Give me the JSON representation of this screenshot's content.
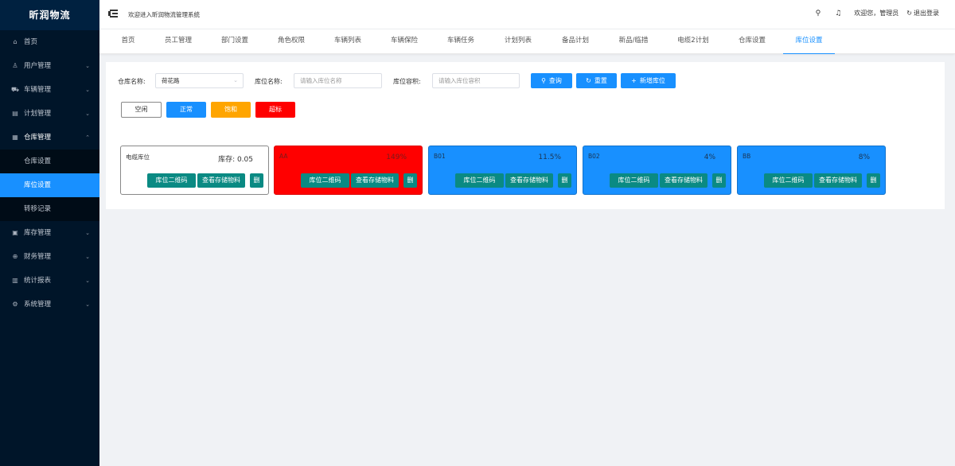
{
  "sidebar": {
    "logo": "昕润物流",
    "items": [
      {
        "label": "首页",
        "icon": "home-icon",
        "glyph": "⌂",
        "arrow": ""
      },
      {
        "label": "用户管理",
        "icon": "user-icon",
        "glyph": "♙",
        "arrow": "⌄"
      },
      {
        "label": "车辆管理",
        "icon": "car-icon",
        "glyph": "⛟",
        "arrow": "⌄"
      },
      {
        "label": "计划管理",
        "icon": "document-icon",
        "glyph": "▤",
        "arrow": "⌄"
      },
      {
        "label": "仓库管理",
        "icon": "warehouse-icon",
        "glyph": "▦",
        "arrow": "⌃"
      }
    ],
    "subitems": [
      {
        "label": "仓库设置"
      },
      {
        "label": "库位设置"
      },
      {
        "label": "转移记录"
      }
    ],
    "items_after": [
      {
        "label": "库存管理",
        "icon": "calendar-icon",
        "glyph": "▣",
        "arrow": "⌄"
      },
      {
        "label": "财务管理",
        "icon": "finance-icon",
        "glyph": "⊕",
        "arrow": "⌄"
      },
      {
        "label": "统计报表",
        "icon": "chart-icon",
        "glyph": "▥",
        "arrow": "⌄"
      },
      {
        "label": "系统管理",
        "icon": "settings-icon",
        "glyph": "⚙",
        "arrow": "⌄"
      }
    ]
  },
  "header": {
    "welcome": "欢迎进入昕润物流管理系统",
    "search_icon": "⚲",
    "bell_icon": "♫",
    "user_greeting": "欢迎您，管理员",
    "logout_icon": "↻",
    "logout": "退出登录"
  },
  "tabs": [
    "首页",
    "员工管理",
    "部门设置",
    "角色权限",
    "车辆列表",
    "车辆保险",
    "车辆任务",
    "计划列表",
    "备品计划",
    "新品/临措",
    "电缆2计划",
    "仓库设置",
    "库位设置"
  ],
  "filters": {
    "warehouse_label": "仓库名称:",
    "warehouse_value": "荷花路",
    "location_label": "库位名称:",
    "location_placeholder": "请输入库位名称",
    "capacity_label": "库位容积:",
    "capacity_placeholder": "请输入库位容积"
  },
  "actions": {
    "search": "查询",
    "reset": "重置",
    "add": "新增库位"
  },
  "legend": [
    {
      "label": "空闲",
      "color": "#ffffff"
    },
    {
      "label": "正常",
      "color": "#1890ff"
    },
    {
      "label": "饱和",
      "color": "#ffa500"
    },
    {
      "label": "超标",
      "color": "#ff0000"
    }
  ],
  "card_buttons": {
    "qr": "库位二维码",
    "view": "查看存储物料",
    "delete": "删"
  },
  "cards": [
    {
      "name": "电缆库位",
      "value": "库存: 0.05",
      "status": "空闲",
      "color": "#ffffff"
    },
    {
      "name": "AA",
      "value": "149%",
      "status": "超标",
      "color": "#ff0000"
    },
    {
      "name": "B01",
      "value": "11.5%",
      "status": "正常",
      "color": "#1890ff"
    },
    {
      "name": "B02",
      "value": "4%",
      "status": "正常",
      "color": "#1890ff"
    },
    {
      "name": "BB",
      "value": "8%",
      "status": "正常",
      "color": "#1890ff"
    }
  ]
}
